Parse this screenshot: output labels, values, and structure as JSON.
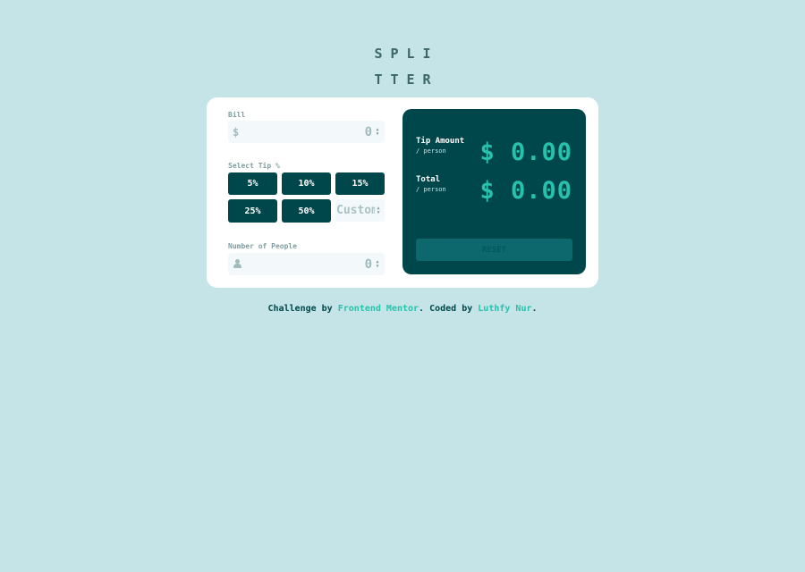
{
  "logo": {
    "line1": "SPLI",
    "line2": "TTER"
  },
  "bill": {
    "label": "Bill",
    "prefix": "$",
    "value": "0"
  },
  "tip": {
    "label": "Select Tip %",
    "options": [
      "5%",
      "10%",
      "15%",
      "25%",
      "50%"
    ],
    "custom_placeholder": "Custom"
  },
  "people": {
    "label": "Number of People",
    "value": "0"
  },
  "results": {
    "tip_title": "Tip Amount",
    "tip_sub": "/ person",
    "tip_amount": "$ 0.00",
    "total_title": "Total",
    "total_sub": "/ person",
    "total_amount": "$ 0.00",
    "reset_label": "RESET"
  },
  "footer": {
    "prefix": "Challenge by ",
    "link1": "Frontend Mentor",
    "middle": ". Coded by ",
    "link2": "Luthfy Nur",
    "suffix": "."
  },
  "colors": {
    "background": "#c5e4e7",
    "dark_cyan": "#00474b",
    "accent": "#26c2ad",
    "white": "#ffffff"
  }
}
